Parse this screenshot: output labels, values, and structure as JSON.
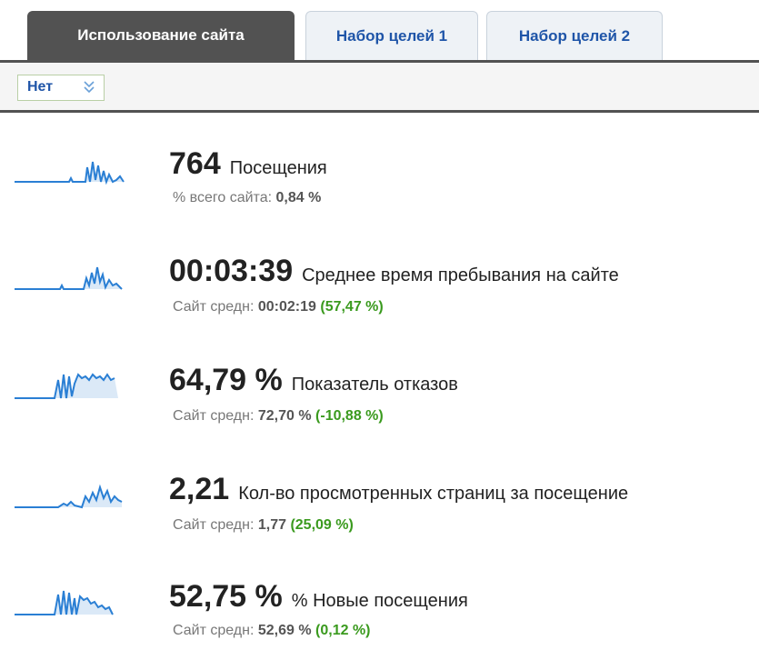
{
  "tabs": [
    {
      "label": "Использование сайта",
      "active": true
    },
    {
      "label": "Набор целей 1",
      "active": false
    },
    {
      "label": "Набор целей 2",
      "active": false
    }
  ],
  "segment_select": {
    "value": "Нет"
  },
  "metrics": [
    {
      "value": "764",
      "label": "Посещения",
      "sub_label": "% всего сайта:",
      "sub_value": "0,84 %",
      "sub_delta": ""
    },
    {
      "value": "00:03:39",
      "label": "Среднее время пребывания на сайте",
      "sub_label": "Сайт средн:",
      "sub_value": "00:02:19",
      "sub_delta": "(57,47 %)"
    },
    {
      "value": "64,79 %",
      "label": "Показатель отказов",
      "sub_label": "Сайт средн:",
      "sub_value": "72,70 %",
      "sub_delta": "(-10,88 %)"
    },
    {
      "value": "2,21",
      "label": "Кол-во просмотренных страниц за посещение",
      "sub_label": "Сайт средн:",
      "sub_value": "1,77",
      "sub_delta": "(25,09 %)"
    },
    {
      "value": "52,75 %",
      "label": "% Новые посещения",
      "sub_label": "Сайт средн:",
      "sub_value": "52,69 %",
      "sub_delta": "(0,12 %)"
    }
  ],
  "colors": {
    "sparkline": "#2a7fd4",
    "sparkline_fill": "#dbe9f7",
    "positive": "#3a9a1e",
    "tab_active": "#525252",
    "link": "#1f55a8"
  }
}
